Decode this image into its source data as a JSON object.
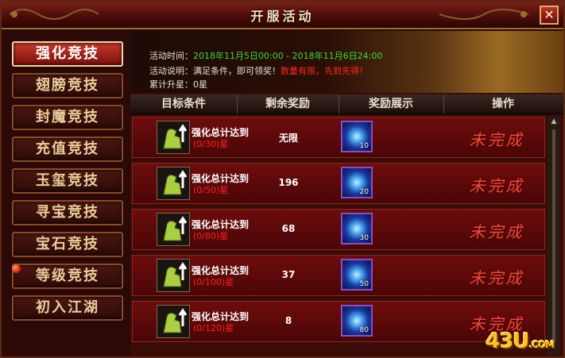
{
  "window": {
    "title": "开服活动",
    "close_label": "✕"
  },
  "sidebar": {
    "items": [
      {
        "label": "强化竞技",
        "active": true
      },
      {
        "label": "翅膀竞技",
        "active": false
      },
      {
        "label": "封魔竞技",
        "active": false
      },
      {
        "label": "充值竞技",
        "active": false
      },
      {
        "label": "玉玺竞技",
        "active": false
      },
      {
        "label": "寻宝竞技",
        "active": false
      },
      {
        "label": "宝石竞技",
        "active": false
      },
      {
        "label": "等级竞技",
        "active": false
      },
      {
        "label": "初入江湖",
        "active": false
      }
    ]
  },
  "info": {
    "time_label": "活动时间：",
    "time_value": "2018年11月5日00:00 - 2018年11月6日24:00",
    "desc_label": "活动说明：满足条件，即可领奖！",
    "desc_highlight": "数量有限，先到先得！",
    "cumulative": "累计升星：0星"
  },
  "table": {
    "headers": [
      "目标条件",
      "剩余奖励",
      "奖励展示",
      "操作"
    ],
    "rows": [
      {
        "condition": "强化总计达到",
        "progress": "(0/30)星",
        "remaining": "无限",
        "item_qty": "10",
        "status": "未完成"
      },
      {
        "condition": "强化总计达到",
        "progress": "(0/50)星",
        "remaining": "196",
        "item_qty": "20",
        "status": "未完成"
      },
      {
        "condition": "强化总计达到",
        "progress": "(0/80)星",
        "remaining": "68",
        "item_qty": "30",
        "status": "未完成"
      },
      {
        "condition": "强化总计达到",
        "progress": "(0/100)星",
        "remaining": "37",
        "item_qty": "50",
        "status": "未完成"
      },
      {
        "condition": "强化总计达到",
        "progress": "(0/120)星",
        "remaining": "8",
        "item_qty": "80",
        "status": "未完成"
      }
    ]
  },
  "watermark": {
    "main": "43U",
    "suffix": ".COM"
  }
}
